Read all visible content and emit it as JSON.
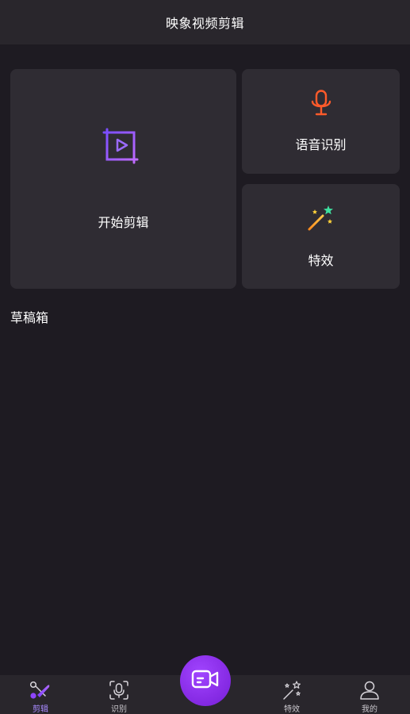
{
  "header": {
    "title": "映象视频剪辑"
  },
  "cards": {
    "start_edit": {
      "label": "开始剪辑",
      "icon": "crop-play-icon"
    },
    "speech": {
      "label": "语音识别",
      "icon": "microphone-icon"
    },
    "effects": {
      "label": "特效",
      "icon": "magic-wand-icon"
    }
  },
  "drafts": {
    "title": "草稿箱"
  },
  "tabbar": {
    "items": [
      {
        "label": "剪辑",
        "icon": "scissors-icon",
        "active": true
      },
      {
        "label": "识别",
        "icon": "voice-scan-icon",
        "active": false
      },
      {
        "label": "特效",
        "icon": "magic-wand-icon",
        "active": false
      },
      {
        "label": "我的",
        "icon": "user-icon",
        "active": false
      }
    ],
    "center_button": {
      "icon": "video-camera-icon"
    }
  },
  "colors": {
    "accent": "#a88aff",
    "fab": "#8a2ee8",
    "background": "#1e1b22",
    "card": "#2f2c33",
    "mic": "#ff5a2a"
  }
}
